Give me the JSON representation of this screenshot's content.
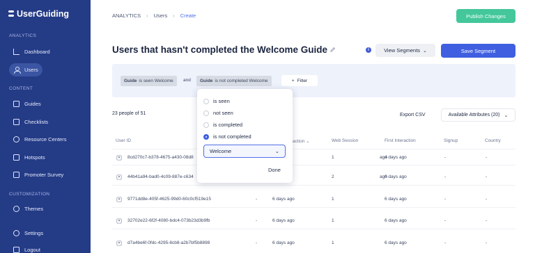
{
  "sidebar": {
    "logo": "UserGuiding",
    "sections": {
      "analytics": "ANALYTICS",
      "content": "CONTENT",
      "customization": "CUSTOMIZATION"
    },
    "items": [
      {
        "label": "Dashboard",
        "icon": "chart-icon"
      },
      {
        "label": "Users",
        "icon": "user-icon"
      },
      {
        "label": "Guides",
        "icon": "guide-icon"
      },
      {
        "label": "Checklists",
        "icon": "checklist-icon"
      },
      {
        "label": "Resource Centers",
        "icon": "resource-center-icon"
      },
      {
        "label": "Hotspots",
        "icon": "hotspot-icon"
      },
      {
        "label": "Promoter Survey",
        "icon": "survey-icon"
      },
      {
        "label": "Themes",
        "icon": "theme-icon"
      },
      {
        "label": "Settings",
        "icon": "gear-icon"
      },
      {
        "label": "Logout",
        "icon": "logout-icon"
      }
    ]
  },
  "breadcrumb": [
    "ANALYTICS",
    "Users",
    "Create"
  ],
  "header": {
    "publish_label": "Publish Changes",
    "title": "Users that hasn't completed the Welcome Guide",
    "view_segments_label": "View Segments",
    "save_label": "Save Segment"
  },
  "filters": {
    "chip1_key": "Guide",
    "chip1_value": "is seen Welcome",
    "and_label": "and",
    "chip2_key": "Guide",
    "chip2_value": "is not completed Welcome",
    "add_filter_label": "Filter"
  },
  "popover": {
    "options": [
      "is seen",
      "not seen",
      "is completed",
      "is not completed"
    ],
    "selected_index": 3,
    "guide_value": "Welcome",
    "done_label": "Done"
  },
  "table": {
    "count_label": "23 people of 51",
    "export_label": "Export CSV",
    "attributes_label": "Available Attributes (20)",
    "headers": [
      "User ID",
      "Last Interaction",
      "Web Session",
      "First Interaction",
      "Signup",
      "Country"
    ],
    "header_visible_fragment": "action",
    "rows": [
      {
        "id": "8cd270c7-b378-4675-a430-08d8",
        "last": "ago",
        "session": "1",
        "first": "4 days ago",
        "signup": "-",
        "country": "-",
        "dash": ""
      },
      {
        "id": "44b41a94-bad0-4c09-887e-c634",
        "last": "ago",
        "session": "2",
        "first": "6 days ago",
        "signup": "-",
        "country": "-",
        "dash": ""
      },
      {
        "id": "9771dd8e-405f-4625-99d0-60c0cf519e15",
        "last": "6 days ago",
        "session": "1",
        "first": "6 days ago",
        "signup": "-",
        "country": "-",
        "dash": "-"
      },
      {
        "id": "32702e22-6f2f-4080-bdc4-073b23d3b9fb",
        "last": "6 days ago",
        "session": "1",
        "first": "6 days ago",
        "signup": "-",
        "country": "-",
        "dash": "-"
      },
      {
        "id": "d7a4be6f-0fdc-4295-8cb8-a2b7bf5b8898",
        "last": "6 days ago",
        "session": "1",
        "first": "6 days ago",
        "signup": "-",
        "country": "-",
        "dash": "-"
      }
    ]
  },
  "colors": {
    "sidebar_bg": "#243b86",
    "primary": "#3f5fe0",
    "publish": "#43c79b"
  }
}
